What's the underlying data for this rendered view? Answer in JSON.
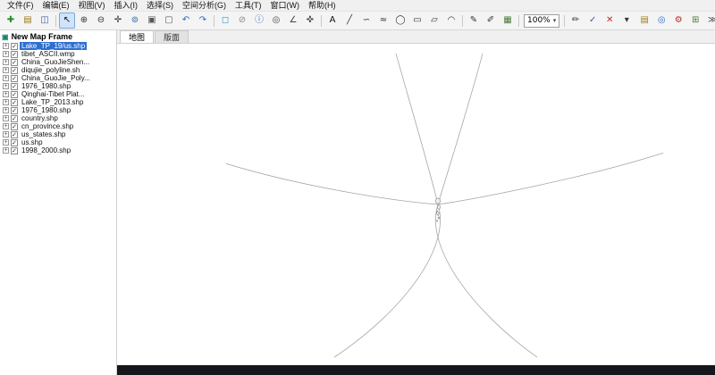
{
  "menu_bar": {
    "items": [
      {
        "name": "menu-file",
        "label": "文件(F)"
      },
      {
        "name": "menu-edit",
        "label": "编辑(E)"
      },
      {
        "name": "menu-view",
        "label": "视图(V)"
      },
      {
        "name": "menu-insert",
        "label": "插入(I)"
      },
      {
        "name": "menu-selection",
        "label": "选择(S)"
      },
      {
        "name": "menu-spatial-analysis",
        "label": "空间分析(G)"
      },
      {
        "name": "menu-tools",
        "label": "工具(T)"
      },
      {
        "name": "menu-window",
        "label": "窗口(W)"
      },
      {
        "name": "menu-help",
        "label": "帮助(H)"
      }
    ]
  },
  "toolbar": {
    "items": [
      {
        "type": "button",
        "name": "add-data",
        "glyph": "✚",
        "color": "#1f8f1f"
      },
      {
        "type": "button",
        "name": "open-map",
        "glyph": "▤",
        "color": "#a07818"
      },
      {
        "type": "button",
        "name": "save-map",
        "glyph": "◫",
        "color": "#2f5fa3"
      },
      {
        "type": "separator"
      },
      {
        "type": "button",
        "name": "select-tool",
        "glyph": "↖",
        "color": "#111111",
        "active": true
      },
      {
        "type": "button",
        "name": "zoom-in",
        "glyph": "⊕",
        "color": "#333333"
      },
      {
        "type": "button",
        "name": "zoom-out",
        "glyph": "⊖",
        "color": "#333333"
      },
      {
        "type": "button",
        "name": "pan",
        "glyph": "✛",
        "color": "#333333"
      },
      {
        "type": "button",
        "name": "full-extent",
        "glyph": "⊚",
        "color": "#2f6fb0"
      },
      {
        "type": "button",
        "name": "fixed-zoom-in",
        "glyph": "▣",
        "color": "#555555"
      },
      {
        "type": "button",
        "name": "fixed-zoom-out",
        "glyph": "▢",
        "color": "#555555"
      },
      {
        "type": "button",
        "name": "back-extent",
        "glyph": "↶",
        "color": "#2d6cc0"
      },
      {
        "type": "button",
        "name": "forward-extent",
        "glyph": "↷",
        "color": "#2d6cc0"
      },
      {
        "type": "separator"
      },
      {
        "type": "button",
        "name": "select-features",
        "glyph": "◻",
        "color": "#2f9bd0"
      },
      {
        "type": "button",
        "name": "clear-selection",
        "glyph": "⊘",
        "color": "#888888"
      },
      {
        "type": "button",
        "name": "identify",
        "glyph": "ⓘ",
        "color": "#2d6cc0"
      },
      {
        "type": "button",
        "name": "find",
        "glyph": "◎",
        "color": "#444444"
      },
      {
        "type": "button",
        "name": "measure",
        "glyph": "∠",
        "color": "#444444"
      },
      {
        "type": "button",
        "name": "go-to-xy",
        "glyph": "✜",
        "color": "#444444"
      },
      {
        "type": "separator"
      },
      {
        "type": "button",
        "name": "text-tool",
        "glyph": "A",
        "color": "#111111"
      },
      {
        "type": "button",
        "name": "line-tool",
        "glyph": "╱",
        "color": "#333333"
      },
      {
        "type": "button",
        "name": "curve-tool",
        "glyph": "∽",
        "color": "#333333"
      },
      {
        "type": "button",
        "name": "freehand-tool",
        "glyph": "≈",
        "color": "#333333"
      },
      {
        "type": "button",
        "name": "circle-tool",
        "glyph": "◯",
        "color": "#333333"
      },
      {
        "type": "button",
        "name": "rectangle-tool",
        "glyph": "▭",
        "color": "#333333"
      },
      {
        "type": "button",
        "name": "polygon-tool",
        "glyph": "▱",
        "color": "#333333"
      },
      {
        "type": "button",
        "name": "arc-tool",
        "glyph": "◠",
        "color": "#333333"
      },
      {
        "type": "separator"
      },
      {
        "type": "button",
        "name": "editor-pencil",
        "glyph": "✎",
        "color": "#333333"
      },
      {
        "type": "button",
        "name": "edit-vertices",
        "glyph": "✐",
        "color": "#333333"
      },
      {
        "type": "button",
        "name": "attributes-table",
        "glyph": "▦",
        "color": "#4a7a3a"
      },
      {
        "type": "separator"
      },
      {
        "type": "combo",
        "name": "zoom-level",
        "value": "100%"
      },
      {
        "type": "separator"
      },
      {
        "type": "button",
        "name": "sketch-tool",
        "glyph": "✏",
        "color": "#333333"
      },
      {
        "type": "button",
        "name": "save-edits",
        "glyph": "✓",
        "color": "#2f5fa3"
      },
      {
        "type": "button",
        "name": "stop-editing",
        "glyph": "✕",
        "color": "#b03030"
      },
      {
        "type": "button",
        "name": "more-tools-dropdown",
        "glyph": "▾",
        "color": "#333333"
      },
      {
        "type": "spacer"
      },
      {
        "type": "button",
        "name": "catalog-window",
        "glyph": "▤",
        "color": "#a07818"
      },
      {
        "type": "button",
        "name": "search-window",
        "glyph": "◎",
        "color": "#2d6cc0"
      },
      {
        "type": "button",
        "name": "toolbox-window",
        "glyph": "⚙",
        "color": "#b03030"
      },
      {
        "type": "button",
        "name": "model-builder",
        "glyph": "⊞",
        "color": "#4a7a3a"
      },
      {
        "type": "button",
        "name": "python-window",
        "glyph": "≫",
        "color": "#444444"
      }
    ],
    "zoom_combo_value": "100%"
  },
  "toc": {
    "root_label": "New Map Frame",
    "layers": [
      {
        "label": "Lake_TP_19/us.shp",
        "checked": true,
        "selected": true
      },
      {
        "label": "tibet_ASCII.wmp",
        "checked": true,
        "selected": false
      },
      {
        "label": "China_GuoJieShen...",
        "checked": true,
        "selected": false
      },
      {
        "label": "diqujie_polyline.sh",
        "checked": true,
        "selected": false
      },
      {
        "label": "China_GuoJie_Poly...",
        "checked": true,
        "selected": false
      },
      {
        "label": "1976_1980.shp",
        "checked": true,
        "selected": false
      },
      {
        "label": "Qinghai-Tibet Plat...",
        "checked": true,
        "selected": false
      },
      {
        "label": "Lake_TP_2013.shp",
        "checked": true,
        "selected": false
      },
      {
        "label": "1976_1980.shp",
        "checked": true,
        "selected": false
      },
      {
        "label": "country.shp",
        "checked": true,
        "selected": false
      },
      {
        "label": "cn_province.shp",
        "checked": true,
        "selected": false
      },
      {
        "label": "us_states.shp",
        "checked": true,
        "selected": false
      },
      {
        "label": "us.shp",
        "checked": true,
        "selected": false
      },
      {
        "label": "1998_2000.shp",
        "checked": true,
        "selected": false
      }
    ]
  },
  "tabs": [
    {
      "name": "tab-map",
      "label": "地图",
      "active": true
    },
    {
      "name": "tab-layout",
      "label": "版面",
      "active": false
    }
  ],
  "colors": {
    "selection_highlight": "#2f6fd0",
    "map_line": "#a5a5a5",
    "bottom_strip": "#16161d",
    "active_tool_bg": "#cfe4fa"
  }
}
